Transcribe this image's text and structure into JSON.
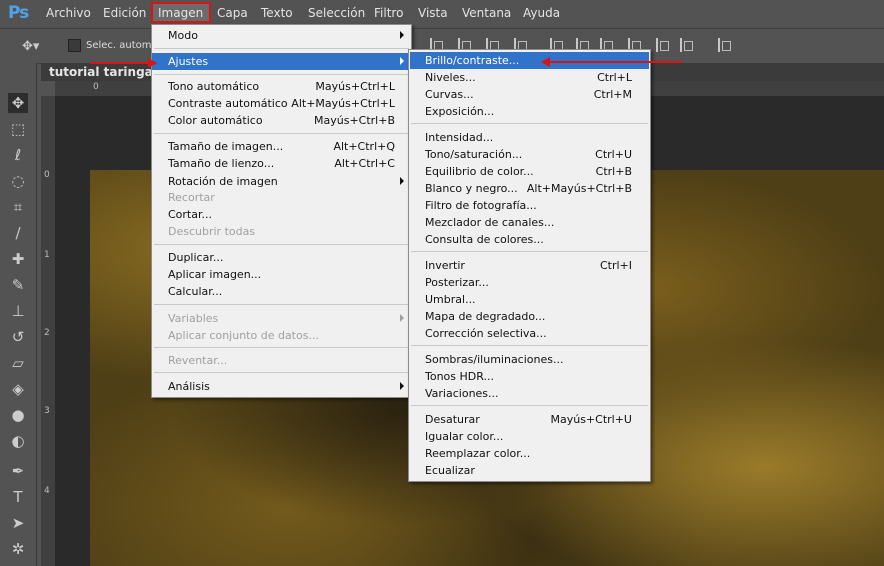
{
  "app_logo": "Ps",
  "menubar": [
    "Archivo",
    "Edición",
    "Imagen",
    "Capa",
    "Texto",
    "Selección",
    "Filtro",
    "Vista",
    "Ventana",
    "Ayuda"
  ],
  "options": {
    "auto_select_label": "Selec. autom.:"
  },
  "document_tab": "tutorial taringa al",
  "rulers": {
    "top": [
      "0"
    ],
    "left": [
      "0",
      "1",
      "2",
      "3",
      "4"
    ]
  },
  "imagen_menu": [
    {
      "label": "Modo",
      "shortcut": "",
      "submenu": true,
      "disabled": false
    },
    {
      "label": "Ajustes",
      "shortcut": "",
      "submenu": true,
      "disabled": false,
      "selected": true
    },
    {
      "label": "Tono automático",
      "shortcut": "Mayús+Ctrl+L"
    },
    {
      "label": "Contraste automático",
      "shortcut": "Alt+Mayús+Ctrl+L"
    },
    {
      "label": "Color automático",
      "shortcut": "Mayús+Ctrl+B"
    },
    {
      "label": "Tamaño de imagen...",
      "shortcut": "Alt+Ctrl+Q"
    },
    {
      "label": "Tamaño de lienzo...",
      "shortcut": "Alt+Ctrl+C"
    },
    {
      "label": "Rotación de imagen",
      "shortcut": "",
      "submenu": true
    },
    {
      "label": "Recortar",
      "shortcut": "",
      "disabled": true
    },
    {
      "label": "Cortar...",
      "shortcut": ""
    },
    {
      "label": "Descubrir todas",
      "shortcut": "",
      "disabled": true
    },
    {
      "label": "Duplicar...",
      "shortcut": ""
    },
    {
      "label": "Aplicar imagen...",
      "shortcut": ""
    },
    {
      "label": "Calcular...",
      "shortcut": ""
    },
    {
      "label": "Variables",
      "shortcut": "",
      "submenu": true,
      "disabled": true
    },
    {
      "label": "Aplicar conjunto de datos...",
      "shortcut": "",
      "disabled": true
    },
    {
      "label": "Reventar...",
      "shortcut": "",
      "disabled": true
    },
    {
      "label": "Análisis",
      "shortcut": "",
      "submenu": true
    }
  ],
  "ajustes_menu": [
    {
      "label": "Brillo/contraste...",
      "shortcut": "",
      "selected": true
    },
    {
      "label": "Niveles...",
      "shortcut": "Ctrl+L"
    },
    {
      "label": "Curvas...",
      "shortcut": "Ctrl+M"
    },
    {
      "label": "Exposición...",
      "shortcut": ""
    },
    {
      "label": "Intensidad...",
      "shortcut": ""
    },
    {
      "label": "Tono/saturación...",
      "shortcut": "Ctrl+U"
    },
    {
      "label": "Equilibrio de color...",
      "shortcut": "Ctrl+B"
    },
    {
      "label": "Blanco y negro...",
      "shortcut": "Alt+Mayús+Ctrl+B"
    },
    {
      "label": "Filtro de fotografía...",
      "shortcut": ""
    },
    {
      "label": "Mezclador de canales...",
      "shortcut": ""
    },
    {
      "label": "Consulta de colores...",
      "shortcut": ""
    },
    {
      "label": "Invertir",
      "shortcut": "Ctrl+I"
    },
    {
      "label": "Posterizar...",
      "shortcut": ""
    },
    {
      "label": "Umbral...",
      "shortcut": ""
    },
    {
      "label": "Mapa de degradado...",
      "shortcut": ""
    },
    {
      "label": "Corrección selectiva...",
      "shortcut": ""
    },
    {
      "label": "Sombras/iluminaciones...",
      "shortcut": ""
    },
    {
      "label": "Tonos HDR...",
      "shortcut": ""
    },
    {
      "label": "Variaciones...",
      "shortcut": ""
    },
    {
      "label": "Desaturar",
      "shortcut": "Mayús+Ctrl+U"
    },
    {
      "label": "Igualar color...",
      "shortcut": ""
    },
    {
      "label": "Reemplazar color...",
      "shortcut": ""
    },
    {
      "label": "Ecualizar",
      "shortcut": ""
    }
  ],
  "colors": {
    "menu_highlight": "#3173c8",
    "annotation_red": "#d81414",
    "ui_gray": "#535353"
  },
  "tools": [
    "move-tool-icon",
    "marquee-tool-icon",
    "lasso-tool-icon",
    "quick-select-tool-icon",
    "crop-tool-icon",
    "eyedropper-tool-icon",
    "healing-tool-icon",
    "brush-tool-icon",
    "stamp-tool-icon",
    "history-brush-tool-icon",
    "eraser-tool-icon",
    "paint-bucket-tool-icon",
    "blur-tool-icon",
    "dodge-tool-icon",
    "pen-tool-icon",
    "type-tool-icon",
    "path-select-tool-icon",
    "shape-tool-icon"
  ]
}
